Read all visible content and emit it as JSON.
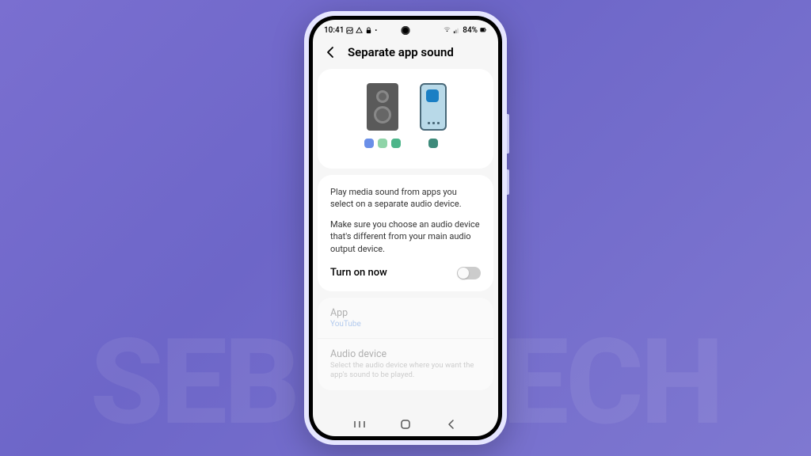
{
  "background_watermark": "SEBERTECH",
  "statusbar": {
    "time": "10:41",
    "battery_text": "84%"
  },
  "header": {
    "title": "Separate app sound"
  },
  "description": {
    "para1": "Play media sound from apps you select on a separate audio device.",
    "para2": "Make sure you choose an audio device that's different from your main audio output device."
  },
  "toggle": {
    "label": "Turn on now",
    "state": "off"
  },
  "settings": {
    "app": {
      "title": "App",
      "value": "YouTube"
    },
    "audio_device": {
      "title": "Audio device",
      "desc": "Select the audio device where you want the app's sound to be played."
    }
  }
}
